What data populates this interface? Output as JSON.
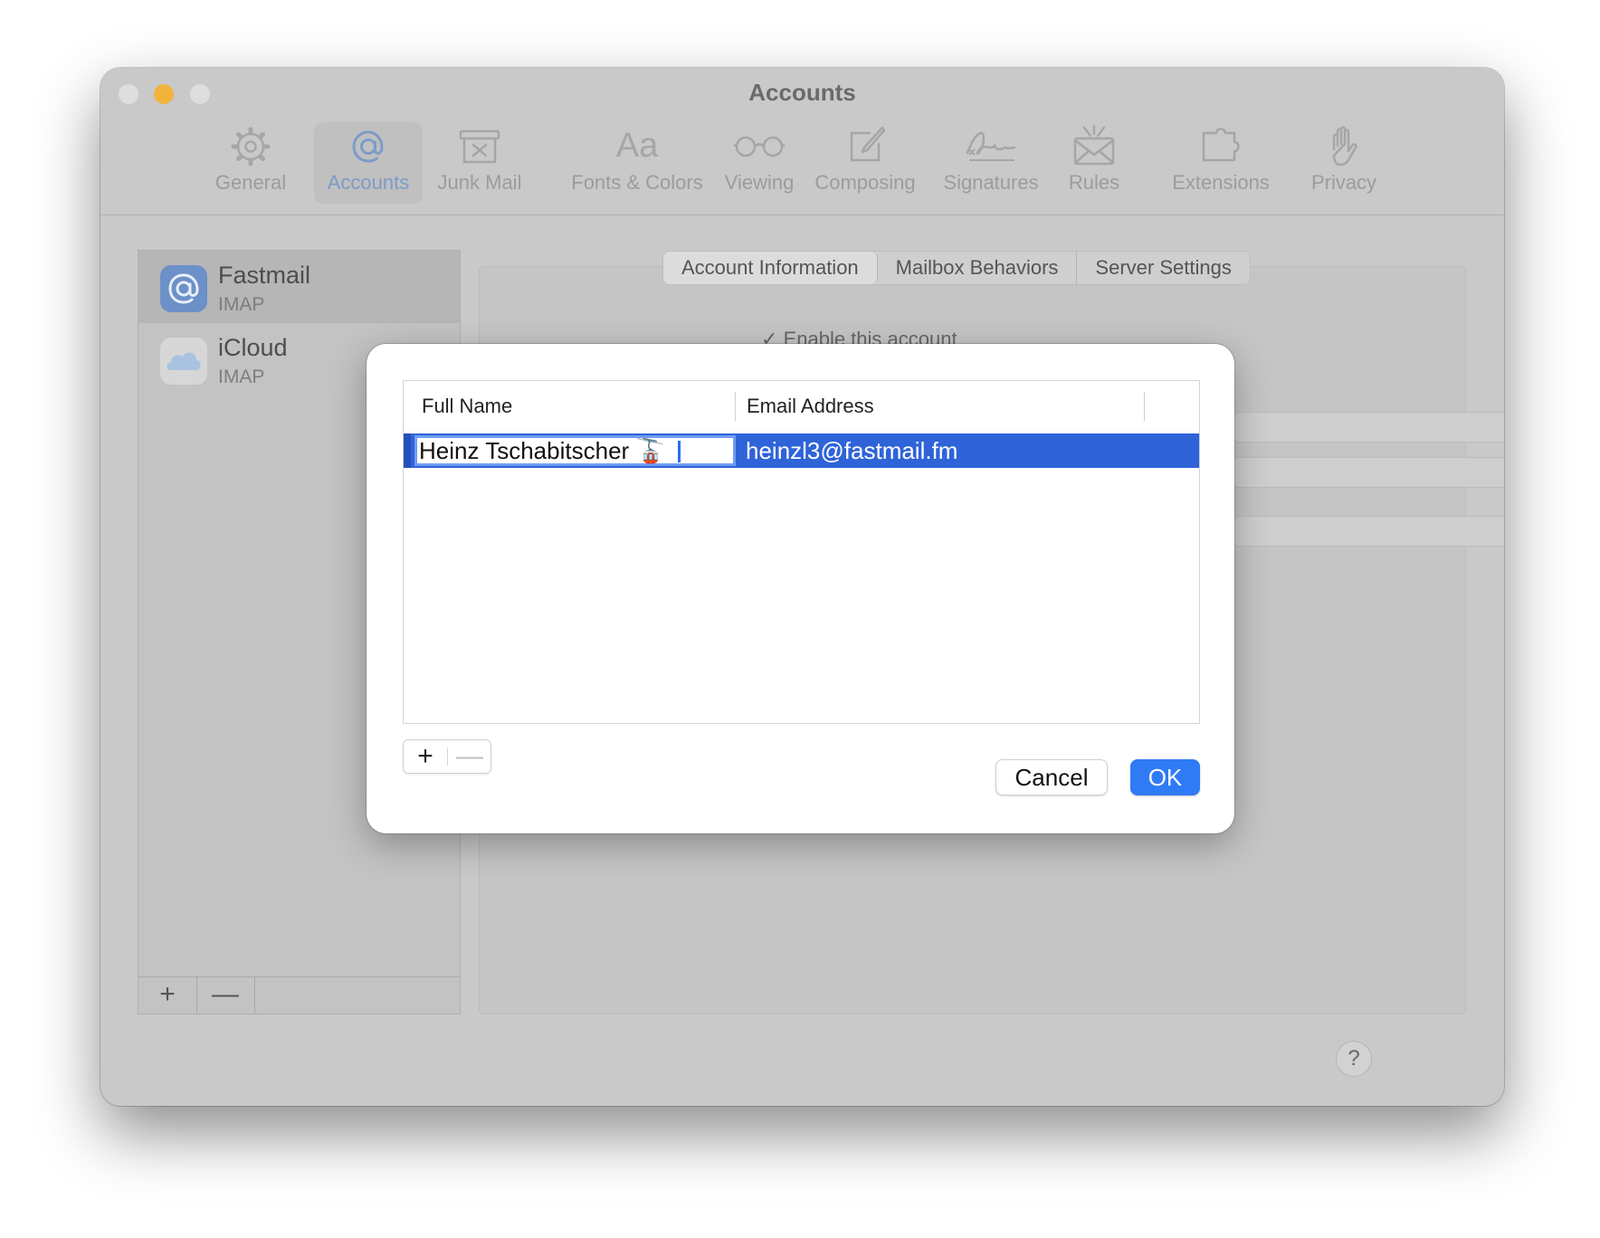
{
  "window": {
    "title": "Accounts"
  },
  "toolbar": {
    "items": [
      {
        "label": "General",
        "icon": "gear-icon"
      },
      {
        "label": "Accounts",
        "icon": "at-icon"
      },
      {
        "label": "Junk Mail",
        "icon": "junk-mail-icon"
      },
      {
        "label": "Fonts & Colors",
        "icon": "fonts-icon"
      },
      {
        "label": "Viewing",
        "icon": "glasses-icon"
      },
      {
        "label": "Composing",
        "icon": "compose-icon"
      },
      {
        "label": "Signatures",
        "icon": "signature-icon"
      },
      {
        "label": "Rules",
        "icon": "rules-icon"
      },
      {
        "label": "Extensions",
        "icon": "puzzle-icon"
      },
      {
        "label": "Privacy",
        "icon": "hand-icon"
      }
    ],
    "fonts_glyph": "Aa"
  },
  "sidebar": {
    "accounts": [
      {
        "name": "Fastmail",
        "type": "IMAP",
        "icon": "at-icon"
      },
      {
        "name": "iCloud",
        "type": "IMAP",
        "icon": "cloud-icon"
      }
    ],
    "add_label": "+",
    "remove_label": "—"
  },
  "tabs": [
    "Account Information",
    "Mailbox Behaviors",
    "Server Settings"
  ],
  "enable_account_label": "Enable this account",
  "help_label": "?",
  "dialog": {
    "columns": [
      "Full Name",
      "Email Address"
    ],
    "rows": [
      {
        "full_name": "Heinz Tschabitscher 🚡",
        "email": "heinzl3@fastmail.fm"
      }
    ],
    "add_label": "+",
    "remove_label": "—",
    "cancel_label": "Cancel",
    "ok_label": "OK"
  },
  "colors": {
    "accent": "#2f7bf5",
    "selection": "#2f63d8",
    "minimize": "#f2b33c"
  }
}
